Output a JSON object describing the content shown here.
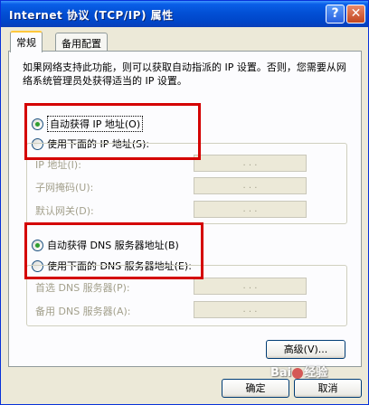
{
  "window": {
    "title": "Internet 协议 (TCP/IP) 属性",
    "help_glyph": "?",
    "close_glyph": "✕"
  },
  "tabs": [
    {
      "label": "常规",
      "active": true
    },
    {
      "label": "备用配置",
      "active": false
    }
  ],
  "description": "如果网络支持此功能，则可以获取自动指派的 IP 设置。否则，您需要从网络系统管理员处获得适当的 IP 设置。",
  "ip_section": {
    "auto_label": "自动获得 IP 地址(O)",
    "manual_label": "使用下面的 IP 地址(S):",
    "auto_selected": true,
    "fields": [
      {
        "label": "IP 地址(I):",
        "dots": ". . ."
      },
      {
        "label": "子网掩码(U):",
        "dots": ". . ."
      },
      {
        "label": "默认网关(D):",
        "dots": ". . ."
      }
    ]
  },
  "dns_section": {
    "auto_label": "自动获得 DNS 服务器地址(B)",
    "manual_label": "使用下面的 DNS 服务器地址(E):",
    "auto_selected": true,
    "fields": [
      {
        "label": "首选 DNS 服务器(P):",
        "dots": ". . ."
      },
      {
        "label": "备用 DNS 服务器(A):",
        "dots": ". . ."
      }
    ]
  },
  "buttons": {
    "advanced": "高级(V)...",
    "ok": "确定",
    "cancel": "取消"
  },
  "watermark": {
    "text_left": "Bai",
    "text_right": "经验"
  },
  "colors": {
    "title_blue": "#0250d5",
    "highlight_red": "#d40000",
    "radio_green": "#2f9e2f"
  }
}
